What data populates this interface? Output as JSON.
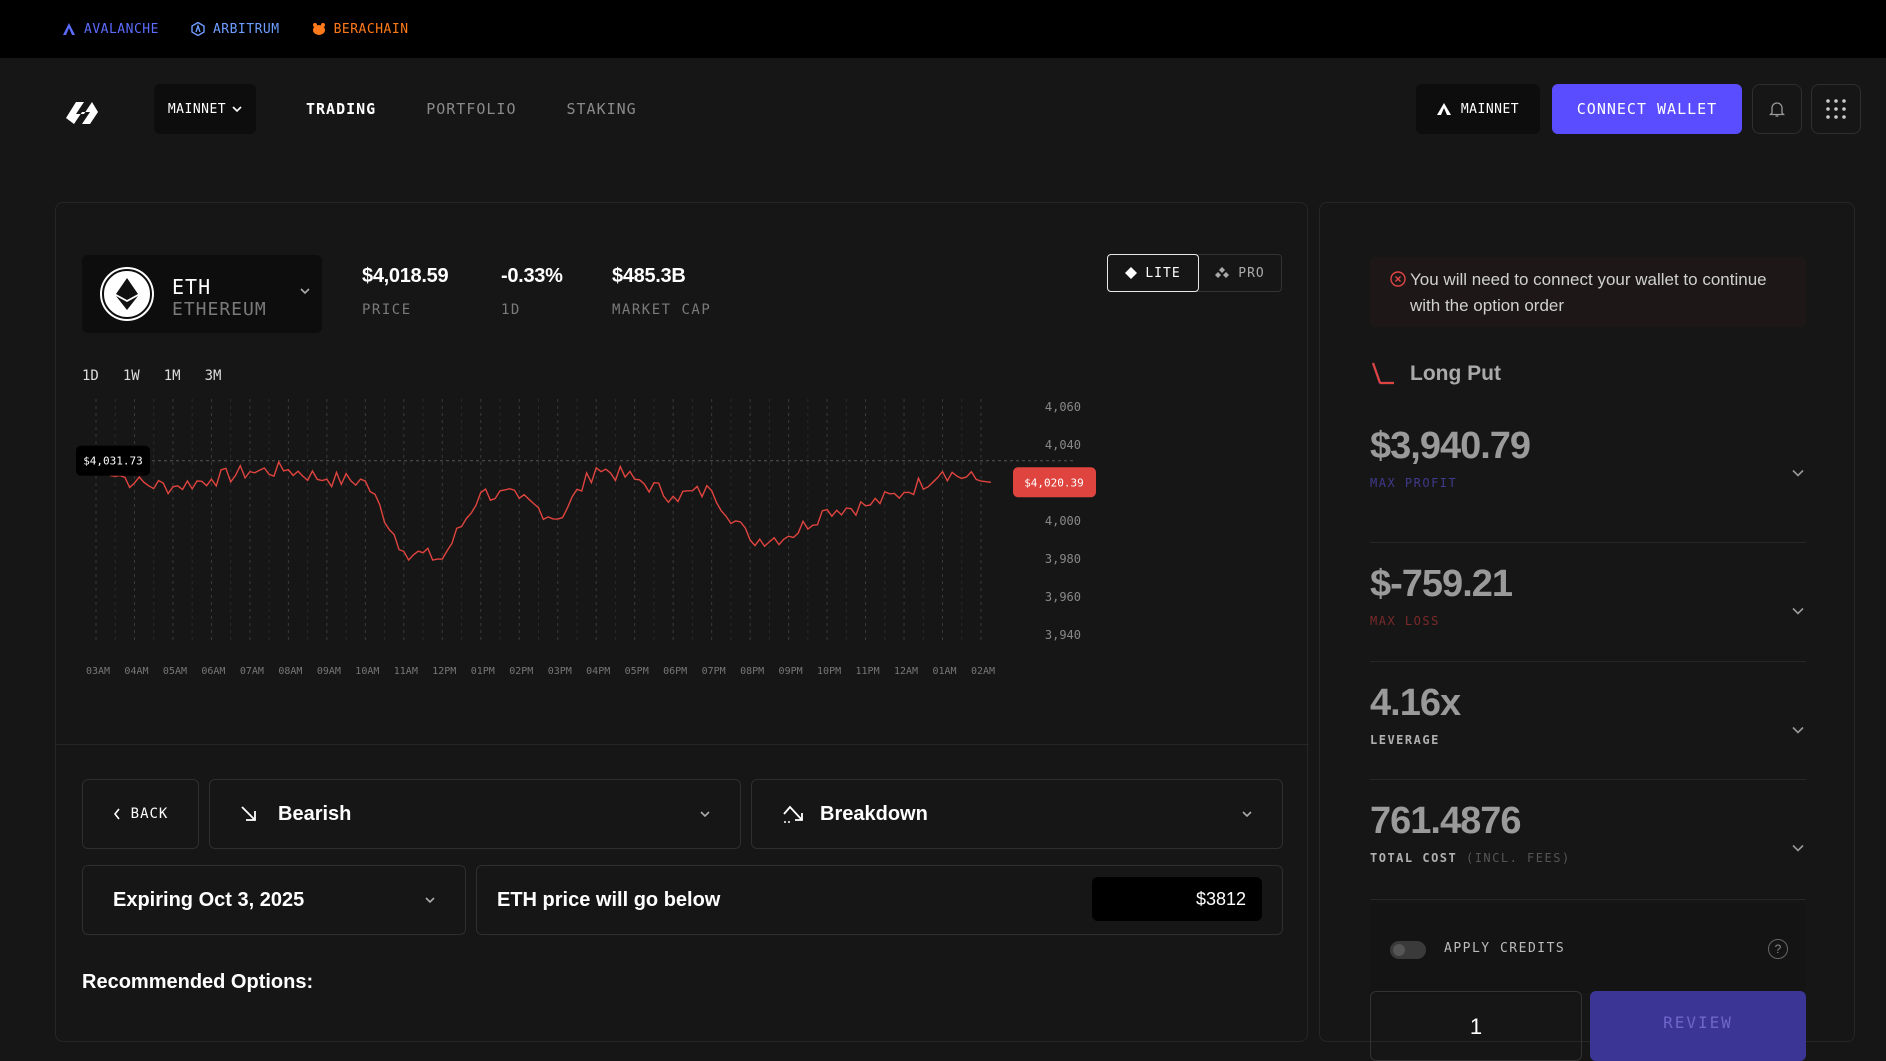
{
  "topbar": {
    "chains": [
      {
        "label": "AVALANCHE",
        "color": "#5b6cff",
        "icon": "avalanche-icon"
      },
      {
        "label": "ARBITRUM",
        "color": "#6d9dff",
        "icon": "arbitrum-icon"
      },
      {
        "label": "BERACHAIN",
        "color": "#ff7a1a",
        "icon": "berachain-icon"
      }
    ]
  },
  "nav": {
    "network_select": "MAINNET",
    "links": [
      "TRADING",
      "PORTFOLIO",
      "STAKING"
    ],
    "active_link": "TRADING",
    "network_badge": "MAINNET",
    "connect_label": "CONNECT WALLET",
    "accent": "#5a4cff"
  },
  "asset": {
    "symbol": "ETH",
    "name": "ETHEREUM",
    "price": "$4,018.59",
    "price_label": "PRICE",
    "change": "-0.33%",
    "change_label": "1D",
    "mcap": "$485.3B",
    "mcap_label": "MARKET CAP"
  },
  "mode": {
    "lite": "LITE",
    "pro": "PRO"
  },
  "timeframes": [
    "1D",
    "1W",
    "1M",
    "3M"
  ],
  "chart_data": {
    "type": "line",
    "x": [
      "03AM",
      "04AM",
      "05AM",
      "06AM",
      "07AM",
      "08AM",
      "09AM",
      "10AM",
      "11AM",
      "12PM",
      "01PM",
      "02PM",
      "03PM",
      "04PM",
      "05PM",
      "06PM",
      "07PM",
      "08PM",
      "09PM",
      "10PM",
      "11PM",
      "12AM",
      "01AM",
      "02AM"
    ],
    "series": [
      {
        "values": [
          4031.73,
          4020,
          4018,
          4022,
          4026,
          4027,
          4022,
          4021,
          3984,
          3980,
          4015,
          4012,
          4001,
          4028,
          4022,
          4013,
          4016,
          3990,
          3992,
          4006,
          4008,
          4015,
          4026,
          4021
        ]
      }
    ],
    "ylim": [
      3940,
      4060
    ],
    "yticks": [
      3940,
      3960,
      3980,
      4000,
      4040,
      4060
    ],
    "ytick_labels": [
      "3,940",
      "3,960",
      "3,980",
      "4,000",
      "4,040",
      "4,060"
    ],
    "open_label": "$4,031.73",
    "open_value": 4031.73,
    "current_label": "$4,020.39",
    "current_value": 4020.39,
    "line_color": "#e0443f",
    "grid": "vertical-dashed"
  },
  "order": {
    "back_label": "BACK",
    "sentiment": "Bearish",
    "strategy": "Breakdown",
    "expiry": "Expiring Oct 3, 2025",
    "condition": "ETH price will go below",
    "target_price": "$3812",
    "recommended_title": "Recommended Options:"
  },
  "panel": {
    "alert": "You will need to connect your wallet to continue with the option order",
    "strategy_name": "Long Put",
    "metrics": [
      {
        "value": "$3,940.79",
        "label": "MAX PROFIT",
        "label_color": "#3f3a8c"
      },
      {
        "value": "$-759.21",
        "label": "MAX LOSS",
        "label_color": "#7a2a2a"
      },
      {
        "value": "4.16x",
        "label": "LEVERAGE",
        "label_color": "#9a9a9a"
      },
      {
        "value": "761.4876",
        "label": "TOTAL COST",
        "sublabel": "(INCL. FEES)",
        "label_color": "#9a9a9a"
      }
    ],
    "credits_label": "APPLY CREDITS",
    "help": "?",
    "quantity": "1",
    "review_label": "REVIEW"
  }
}
